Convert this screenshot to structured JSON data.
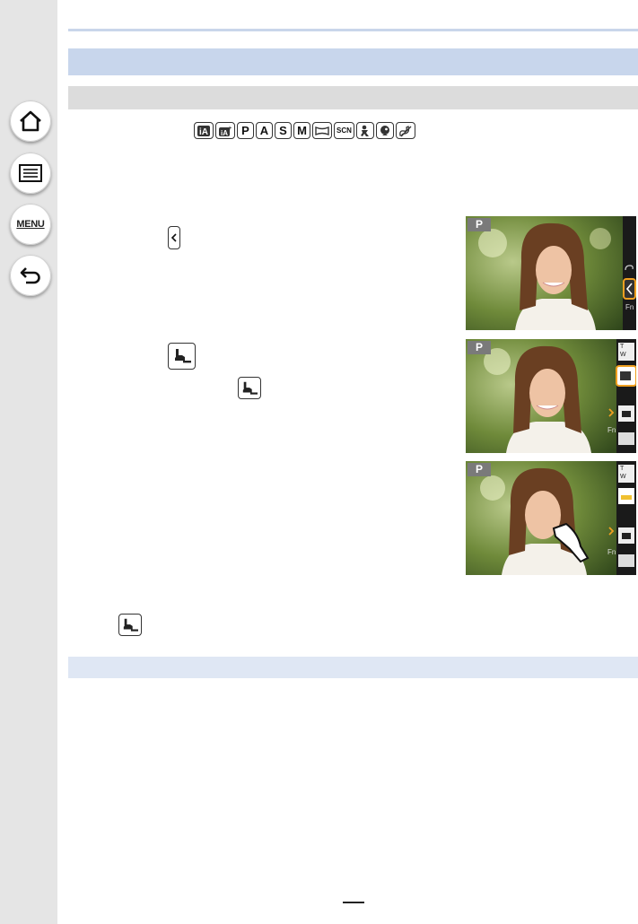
{
  "sidebar": {
    "home_icon": "home-icon",
    "contents_icon": "list-icon",
    "menu_label": "MENU",
    "back_icon": "back-arrow-icon"
  },
  "modes": [
    "iA",
    "iA+",
    "P",
    "A",
    "S",
    "M",
    "panorama",
    "SCN",
    "creative-video",
    "portrait",
    "creative-control"
  ],
  "mode_labels": {
    "p": "P",
    "a": "A",
    "s": "S",
    "m": "M",
    "scn": "SCN"
  },
  "screens": [
    {
      "mode_badge": "P",
      "side_labels": [
        "Fn"
      ]
    },
    {
      "mode_badge": "P",
      "side_labels": [
        "T",
        "W",
        "Fn"
      ]
    },
    {
      "mode_badge": "P",
      "side_labels": [
        "T",
        "W",
        "Fn"
      ]
    }
  ],
  "colors": {
    "section_bar": "#c8d6ec",
    "sub_bar": "#dcdcdc",
    "highlight": "#f0a020",
    "sidebar": "#e5e5e5"
  }
}
